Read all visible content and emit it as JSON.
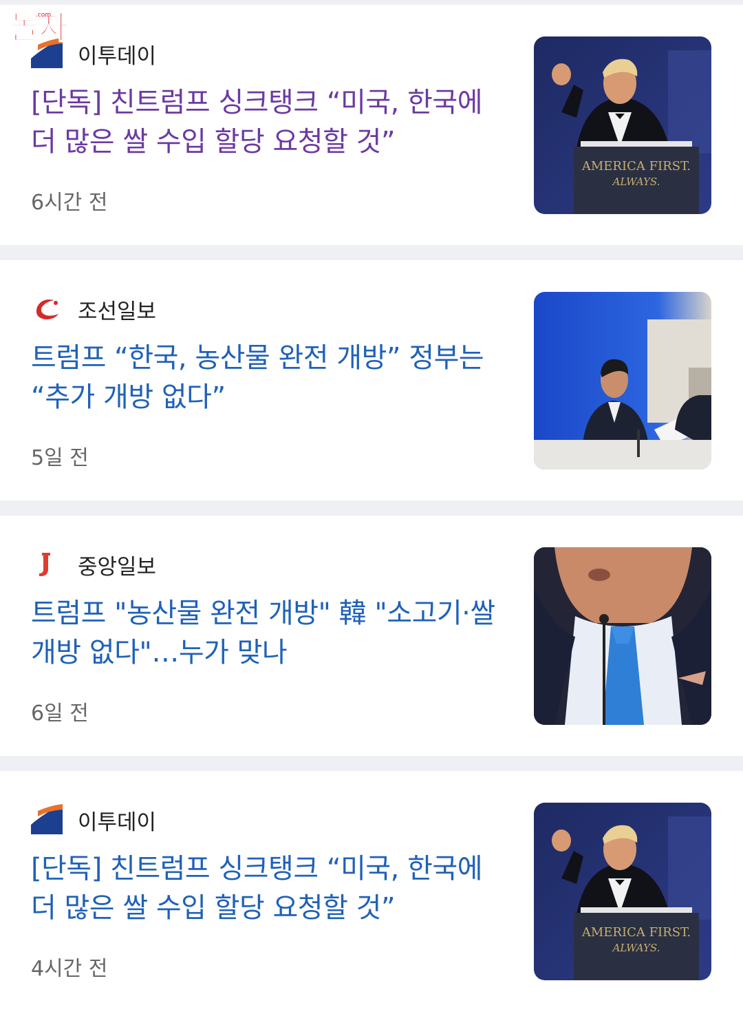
{
  "watermark": {
    "text": "놀자",
    "small": ".com"
  },
  "articles": [
    {
      "source": "이투데이",
      "logo": "etoday-logo",
      "headline": "[단독] 친트럼프 싱크탱크 “미국, 한국에 더 많은 쌀 수입 할당 요청할 것”",
      "time": "6시간 전",
      "visited": true,
      "image": {
        "icon": "trump-podium-photo",
        "banner_line1": "AMERICA FIRST.",
        "banner_line2": "ALWAYS."
      }
    },
    {
      "source": "조선일보",
      "logo": "chosun-logo",
      "headline": "트럼프 “한국, 농산물 완전 개방” 정부는 “추가 개방 없다”",
      "time": "5일 전",
      "visited": false,
      "image": {
        "icon": "press-briefing-photo"
      }
    },
    {
      "source": "중앙일보",
      "logo": "joongang-logo",
      "headline": "트럼프 \"농산물 완전 개방\" 韓 \"소고기·쌀 개방 없다\"…누가 맞나",
      "time": "6일 전",
      "visited": false,
      "image": {
        "icon": "trump-closeup-photo"
      }
    },
    {
      "source": "이투데이",
      "logo": "etoday-logo",
      "headline": "[단독] 친트럼프 싱크탱크 “미국, 한국에 더 많은 쌀 수입 할당 요청할 것”",
      "time": "4시간 전",
      "visited": false,
      "image": {
        "icon": "trump-podium-photo",
        "banner_line1": "AMERICA FIRST.",
        "banner_line2": "ALWAYS."
      }
    }
  ],
  "colors": {
    "visited_link": "#6b3aa3",
    "link": "#1f61b8",
    "meta": "#666666",
    "separator": "#eef0f3"
  }
}
